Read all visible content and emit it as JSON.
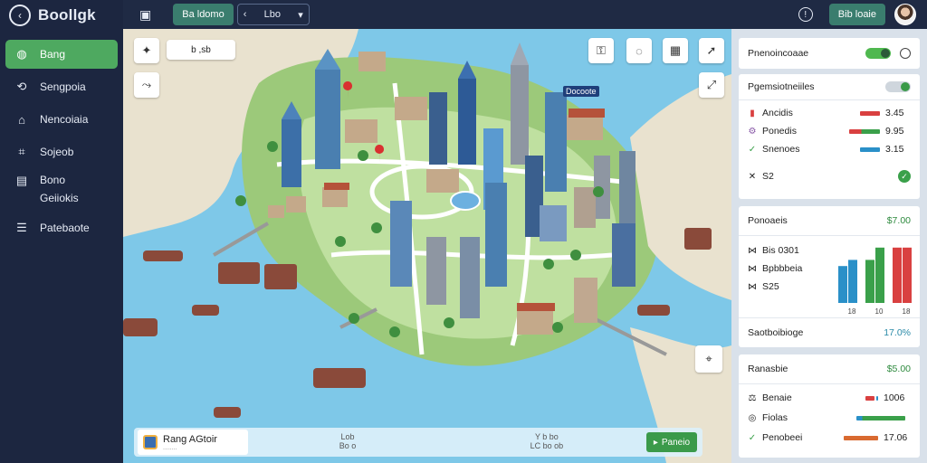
{
  "app": {
    "title": "Boollgk"
  },
  "sidebar": {
    "items": [
      {
        "label": "Bang",
        "icon": "globe-icon"
      },
      {
        "label": "Sengpoia",
        "icon": "route-icon"
      },
      {
        "label": "Nencoiaia",
        "icon": "home-icon"
      },
      {
        "label": "Sojeob",
        "icon": "tag-icon"
      },
      {
        "label": "Bono",
        "label2": "Geiiokis",
        "icon": "bus-icon"
      },
      {
        "label": "Patebaote",
        "icon": "layers-icon"
      }
    ]
  },
  "topbar": {
    "pill": "Ba ldomo",
    "select": "Lbo",
    "button": "Bib loaie"
  },
  "map": {
    "search_placeholder": "b ,sb",
    "tag": "Docoote",
    "bottom": {
      "card_label": "Rang AGtoir",
      "card_sub": "........",
      "mid_1": "Lob",
      "mid_2": "Bo o",
      "mid_3": "Y b bo",
      "mid_4": "LC bo ob",
      "go_button": "Paneio"
    }
  },
  "panel": {
    "card1": {
      "label": "Pnenoincoaae"
    },
    "card2": {
      "title": "Pgemsiotneiiles",
      "rows": [
        {
          "label": "Ancidis",
          "value": "3.45",
          "color": "#d94040",
          "icon": "chart-icon"
        },
        {
          "label": "Ponedis",
          "value": "9.95",
          "color": "#3aa04a",
          "icon": "gear-icon"
        },
        {
          "label": "Snenoes",
          "value": "3.15",
          "color": "#2a90c8",
          "icon": "check-icon"
        }
      ],
      "total": "S2"
    },
    "card3": {
      "title": "Ponoaeis",
      "value": "$7.00",
      "rows": [
        {
          "label": "Bis 0301"
        },
        {
          "label": "Bpbbbeia"
        },
        {
          "label": "S25"
        }
      ],
      "chart_data": {
        "type": "bar",
        "categories": [
          "",
          "",
          "",
          "",
          "",
          ""
        ],
        "series": [
          {
            "values": [
              6,
              7,
              7,
              9,
              9,
              9
            ]
          }
        ],
        "bar_colors": [
          "#2a90c8",
          "#2a90c8",
          "#3aa04a",
          "#3aa04a",
          "#d94040",
          "#d94040"
        ],
        "tick_labels": [
          "18",
          "10",
          "18"
        ],
        "ylim": [
          0,
          10
        ]
      },
      "footer_label": "Saotboibioge",
      "footer_value": "17.0%"
    },
    "card4": {
      "title": "Ranasbie",
      "value": "$5.00",
      "rows": [
        {
          "label": "Benaie",
          "value": "1006",
          "color": "#d94040",
          "icon": "info-icon"
        },
        {
          "label": "Fiolas",
          "value": "",
          "color": "#3aa04a",
          "icon": "box-icon"
        },
        {
          "label": "Penobeei",
          "value": "17.06",
          "color": "#d96a30",
          "icon": "check-icon"
        }
      ]
    }
  }
}
